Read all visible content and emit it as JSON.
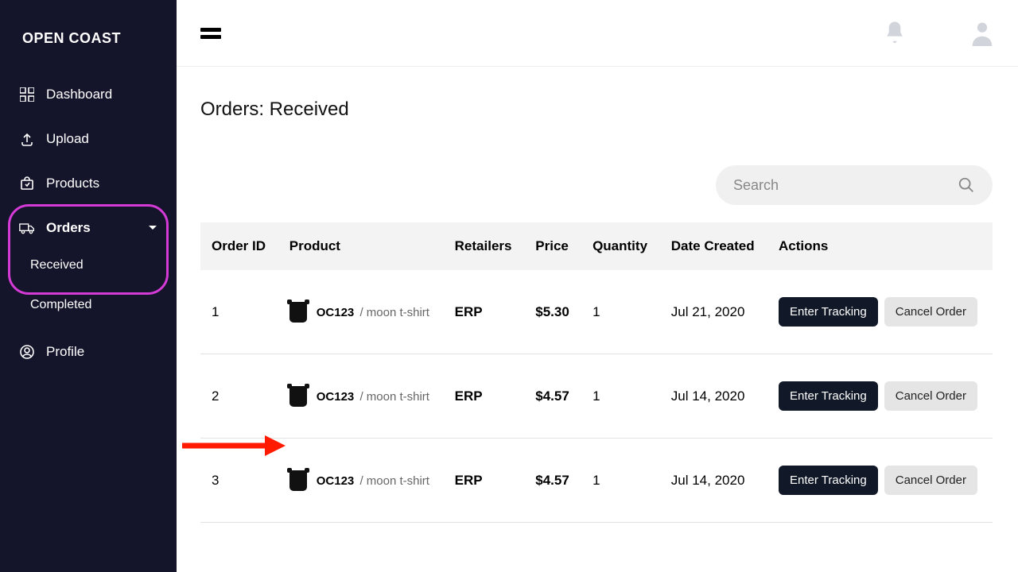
{
  "brand": "OPEN COAST",
  "sidebar": {
    "items": [
      {
        "label": "Dashboard"
      },
      {
        "label": "Upload"
      },
      {
        "label": "Products"
      },
      {
        "label": "Orders"
      },
      {
        "label": "Profile"
      }
    ],
    "orders_sub": {
      "received": "Received",
      "completed": "Completed"
    }
  },
  "page": {
    "title": "Orders: Received"
  },
  "search": {
    "placeholder": "Search"
  },
  "table": {
    "headers": {
      "order_id": "Order ID",
      "product": "Product",
      "retailers": "Retailers",
      "price": "Price",
      "quantity": "Quantity",
      "date_created": "Date Created",
      "actions": "Actions"
    },
    "rows": [
      {
        "order_id": "1",
        "sku": "OC123",
        "product_name": "moon t-shirt",
        "retailer": "ERP",
        "price": "$5.30",
        "quantity": "1",
        "date_created": "Jul 21, 2020"
      },
      {
        "order_id": "2",
        "sku": "OC123",
        "product_name": "moon t-shirt",
        "retailer": "ERP",
        "price": "$4.57",
        "quantity": "1",
        "date_created": "Jul 14, 2020"
      },
      {
        "order_id": "3",
        "sku": "OC123",
        "product_name": "moon t-shirt",
        "retailer": "ERP",
        "price": "$4.57",
        "quantity": "1",
        "date_created": "Jul 14, 2020"
      }
    ],
    "action_labels": {
      "enter_tracking": "Enter Tracking",
      "cancel_order": "Cancel Order"
    }
  },
  "annotation": {
    "arrow_target_row": 2
  }
}
